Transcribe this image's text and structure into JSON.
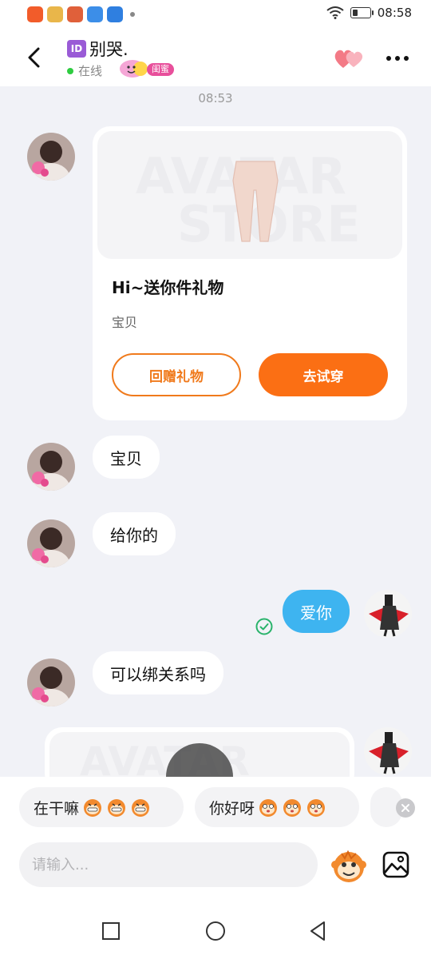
{
  "status_bar": {
    "time": "08:58"
  },
  "header": {
    "id_badge": "ID",
    "name": "别哭.",
    "status": "在线",
    "relationship_badge": "闺蜜"
  },
  "messages": {
    "timestamp": "08:53",
    "gift_card": {
      "title": "Hi~送你件礼物",
      "subtitle": "宝贝",
      "return_gift_button": "回赠礼物",
      "try_on_button": "去试穿",
      "watermark_line1": "AVATAR",
      "watermark_line2": "STORE"
    },
    "msg_1": "宝贝",
    "msg_2": "给你的",
    "msg_mine": "爱你",
    "msg_3": "可以绑关系吗"
  },
  "quick_replies": [
    {
      "text": "在干嘛"
    },
    {
      "text": "你好呀"
    }
  ],
  "composer": {
    "placeholder": "请输入..."
  },
  "colors": {
    "accent_orange": "#fb6f14",
    "my_bubble": "#3eb4f0",
    "online_green": "#2ecc40",
    "badge_pink": "#e84f9b"
  }
}
